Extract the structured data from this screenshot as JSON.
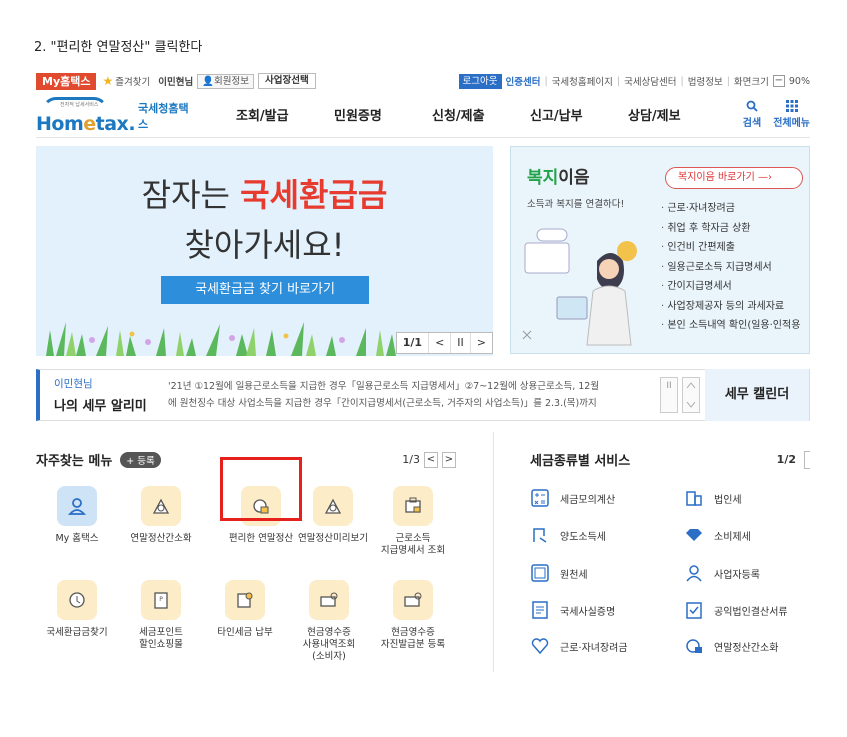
{
  "instruction": "2. \"편리한 연말정산\" 클릭한다",
  "topbar": {
    "myhome": "My홈택스",
    "favorites": "즐겨찾기",
    "user": "이민현님",
    "member_info": "회원정보",
    "business_select": "사업장선택",
    "logout": "로그아웃",
    "cert_center": "인증센터",
    "links": [
      "국세청홈페이지",
      "국세상담센터",
      "법령정보",
      "화면크기"
    ],
    "zoom": "90%"
  },
  "header": {
    "logo_small": "전자적 납세서비스",
    "logo_text_1": "Hom",
    "logo_text_2": "e",
    "logo_text_3": "tax.",
    "logo_sub": "국세청홈택스",
    "nav": [
      "조회/발급",
      "민원증명",
      "신청/제출",
      "신고/납부",
      "상담/제보"
    ],
    "search_label": "검색",
    "allmenu_label": "전체메뉴"
  },
  "banner_left": {
    "line1_prefix": "잠자는 ",
    "line1_highlight": "국세환급금",
    "line2": "찾아가세요!",
    "button": "국세환급금 찾기 바로가기",
    "page": "1/1",
    "prev": "<",
    "pause": "II",
    "next": ">"
  },
  "banner_right": {
    "title_highlight": "복지",
    "title_rest": "이음",
    "subtitle": "소득과 복지를 연결하다!",
    "button": "복지이음 바로가기",
    "list": [
      "근로·자녀장려금",
      "취업 후 학자금 상환",
      "인건비 간편제출",
      "일용근로소득 지급명세서",
      "간이지급명세서",
      "사업장제공자 등의 과세자료",
      "본인 소득내역 확인(일용·인적용"
    ]
  },
  "notice": {
    "user": "이민현님",
    "title": "나의 세무 알리미",
    "line1": "'21년 ①12월에 일용근로소득을 지급한 경우「일용근로소득 지급명세서」②7~12월에 상용근로소득, 12월",
    "line2": "에 원천징수 대상 사업소득을 지급한 경우「간이지급명세서(근로소득, 거주자의 사업소득)」를 2.3.(목)까지",
    "pause": "II",
    "calendar": "세무 캘린더"
  },
  "favorites": {
    "title": "자주찾는 메뉴",
    "register": "+ 등록",
    "page": "1/3",
    "prev": "<",
    "next": ">",
    "items": [
      {
        "label": "My 홈택스",
        "icon": "person-icon"
      },
      {
        "label": "연말정산간소화",
        "icon": "calculator-icon"
      },
      {
        "label": "편리한 연말정산",
        "icon": "easy-settlement-icon"
      },
      {
        "label": "연말정산미리보기",
        "icon": "preview-icon"
      },
      {
        "label": "근로소득\n지급명세서 조회",
        "icon": "statement-icon"
      },
      {
        "label": "국세환급금찾기",
        "icon": "refund-icon"
      },
      {
        "label": "세금포인트\n할인쇼핑몰",
        "icon": "tax-point-icon"
      },
      {
        "label": "타인세금 납부",
        "icon": "other-tax-icon"
      },
      {
        "label": "현금영수증\n사용내역조회\n(소비자)",
        "icon": "receipt-icon"
      },
      {
        "label": "현금영수증\n자진발급분 등록",
        "icon": "receipt-register-icon"
      }
    ]
  },
  "services": {
    "title": "세금종류별 서비스",
    "page": "1/2",
    "items": [
      {
        "label": "세금모의계산",
        "icon": "calc-icon"
      },
      {
        "label": "법인세",
        "icon": "building-icon"
      },
      {
        "label": "양도소득세",
        "icon": "transfer-icon"
      },
      {
        "label": "소비제세",
        "icon": "diamond-icon"
      },
      {
        "label": "원천세",
        "icon": "withholding-icon"
      },
      {
        "label": "사업자등록",
        "icon": "person-outline-icon"
      },
      {
        "label": "국세사실증명",
        "icon": "certificate-icon"
      },
      {
        "label": "공익법인결산서류",
        "icon": "checklist-icon"
      },
      {
        "label": "근로·자녀장려금",
        "icon": "heart-icon"
      },
      {
        "label": "연말정산간소화",
        "icon": "simplify-icon"
      }
    ]
  },
  "colors": {
    "brand_blue": "#1c78c0",
    "accent_red": "#e63b2e",
    "highlight_box": "#e6201b",
    "welfare_green": "#22a24a"
  }
}
